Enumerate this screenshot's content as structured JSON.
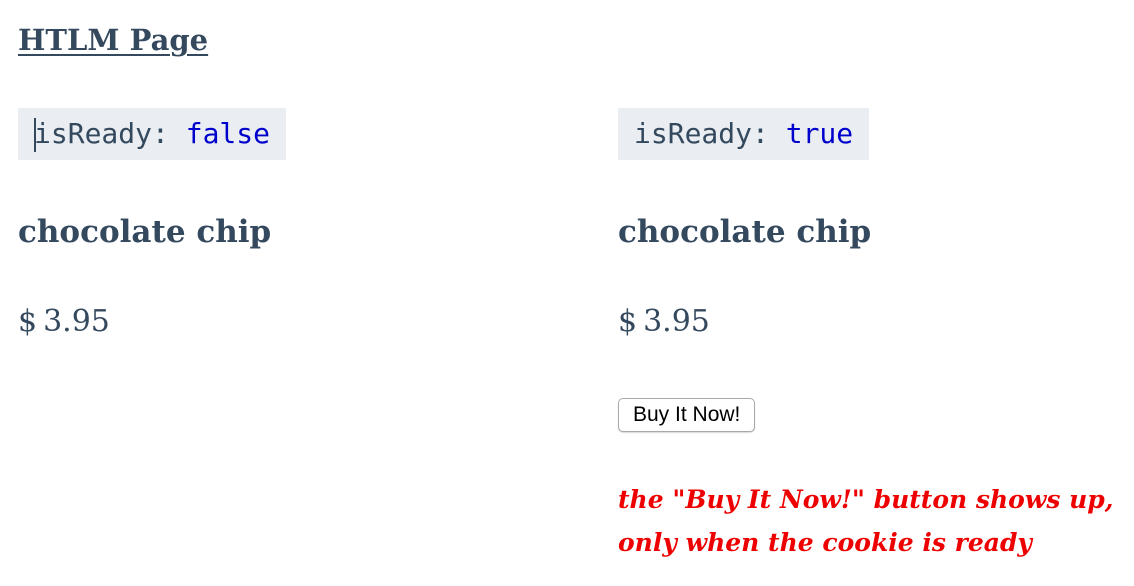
{
  "page": {
    "title": "HTLM Page"
  },
  "left_panel": {
    "code": {
      "key": "isReady:",
      "value": "false"
    },
    "product_name": "chocolate chip",
    "price": {
      "currency": "$",
      "amount": "3.95"
    }
  },
  "right_panel": {
    "code": {
      "key": "isReady:",
      "value": "true"
    },
    "product_name": "chocolate chip",
    "price": {
      "currency": "$",
      "amount": "3.95"
    },
    "buy_button_label": "Buy It Now!",
    "note_line1": "the \"Buy It Now!\" button shows up,",
    "note_line2": "only when the cookie is ready"
  },
  "colors": {
    "text": "#34495e",
    "code_background": "#eaeef2",
    "code_value": "#0000cc",
    "note": "#ee0000"
  }
}
